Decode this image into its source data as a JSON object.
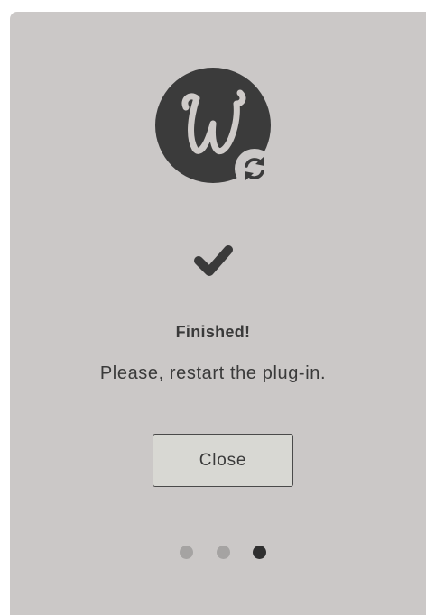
{
  "dialog": {
    "logo_icon": "w-plugin-logo-icon",
    "badge_icon": "refresh-icon",
    "status_icon": "checkmark-icon",
    "title": "Finished!",
    "message": "Please, restart the plug-in.",
    "close_label": "Close"
  },
  "pager": {
    "total": 3,
    "current": 3
  },
  "colors": {
    "panel_bg": "#cbc8c7",
    "logo_bg": "#3b3b3b",
    "text": "#3a3a3a",
    "dot_inactive": "#a5a3a2",
    "dot_active": "#2f2f2f",
    "button_bg": "#d8d8d3",
    "button_border": "#4a4a4a"
  }
}
